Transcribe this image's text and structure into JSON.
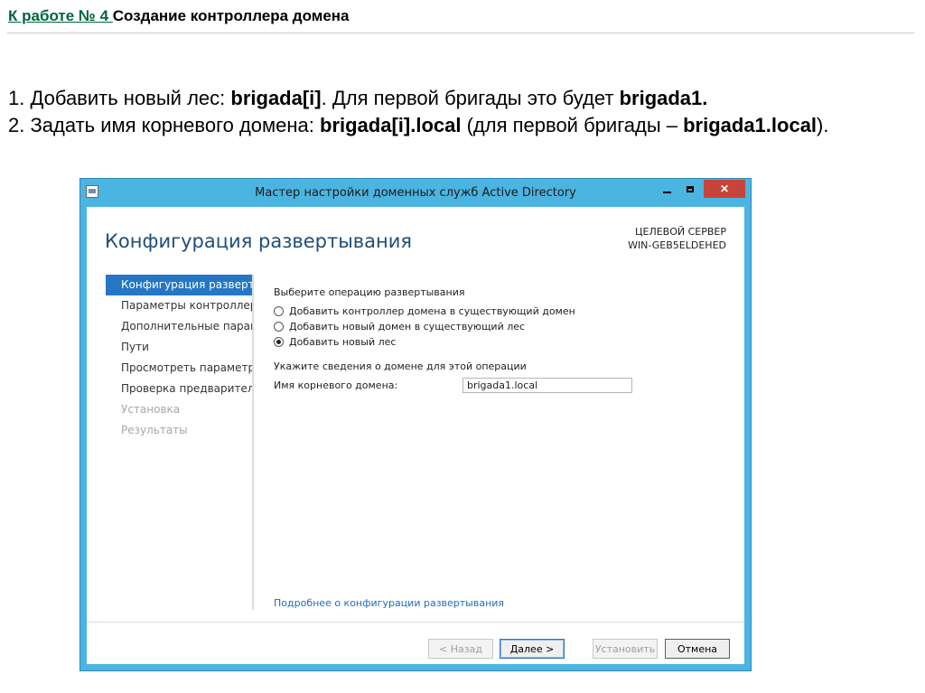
{
  "slide": {
    "title_link": "К работе № 4 ",
    "title_rest": "Создание контроллера домена",
    "line1_pre": "1. Добавить новый лес: ",
    "line1_bold1": "brigada[i]",
    "line1_mid": ". Для первой бригады это будет ",
    "line1_bold2": "brigada1.",
    "line2_pre": "2. Задать имя корневого домена: ",
    "line2_bold1": "brigada[i].local",
    "line2_mid": " (для первой бригады – ",
    "line2_bold2": "brigada1.local",
    "line2_end": ")."
  },
  "window": {
    "title": "Мастер настройки доменных служб Active Directory",
    "close_glyph": "✕",
    "heading": "Конфигурация развертывания",
    "target_server_label": "ЦЕЛЕВОЙ СЕРВЕР",
    "target_server_name": "WIN-GEB5ELDEHED"
  },
  "nav": {
    "items": [
      {
        "label": "Конфигурация разверты...",
        "state": "active"
      },
      {
        "label": "Параметры контроллера...",
        "state": "normal"
      },
      {
        "label": "Дополнительные парам...",
        "state": "normal"
      },
      {
        "label": "Пути",
        "state": "normal"
      },
      {
        "label": "Просмотреть параметры",
        "state": "normal"
      },
      {
        "label": "Проверка предваритель...",
        "state": "normal"
      },
      {
        "label": "Установка",
        "state": "disabled"
      },
      {
        "label": "Результаты",
        "state": "disabled"
      }
    ]
  },
  "content": {
    "operation_label": "Выберите операцию развертывания",
    "options": [
      {
        "label": "Добавить контроллер домена в существующий домен",
        "checked": false
      },
      {
        "label": "Добавить новый домен в существующий лес",
        "checked": false
      },
      {
        "label": "Добавить новый лес",
        "checked": true
      }
    ],
    "domain_info_label": "Укажите сведения о домене для этой операции",
    "root_domain_label": "Имя корневого домена:",
    "root_domain_value": "brigada1.local",
    "more_link": "Подробнее о конфигурации развертывания"
  },
  "footer": {
    "back_label": "< Назад",
    "next_label": "Далее >",
    "install_label": "Установить",
    "cancel_label": "Отмена"
  }
}
